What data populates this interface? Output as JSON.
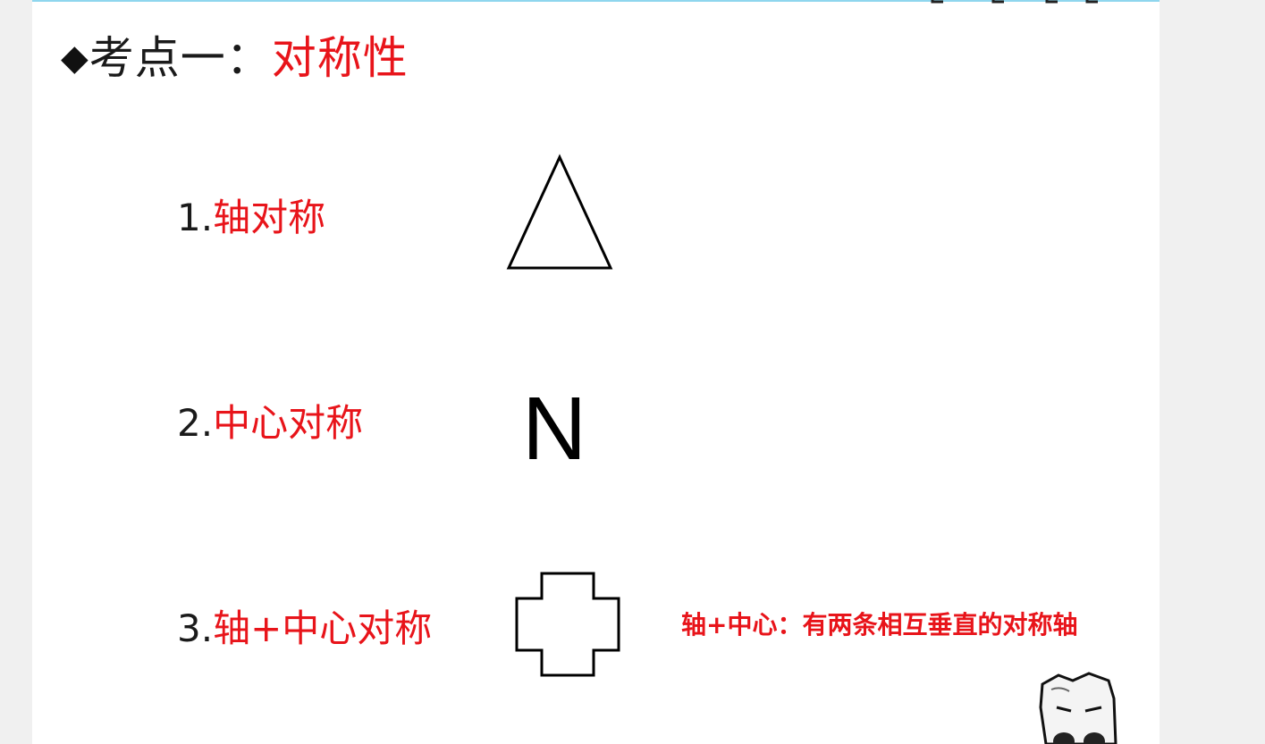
{
  "slide": {
    "title": {
      "bullet": "◆",
      "label": "考点一：",
      "topic": "对称性"
    },
    "items": [
      {
        "num": "1.",
        "text": "轴对称",
        "shape": "triangle-icon"
      },
      {
        "num": "2.",
        "text": "中心对称",
        "shape": "letter-n",
        "glyph": "N"
      },
      {
        "num": "3.",
        "text": "轴+中心对称",
        "shape": "cross-icon"
      }
    ],
    "note": "轴+中心：有两条相互垂直的对称轴"
  },
  "colors": {
    "accent": "#e8141a",
    "text": "#1a1a1a",
    "top_line": "#8fd6ee"
  }
}
